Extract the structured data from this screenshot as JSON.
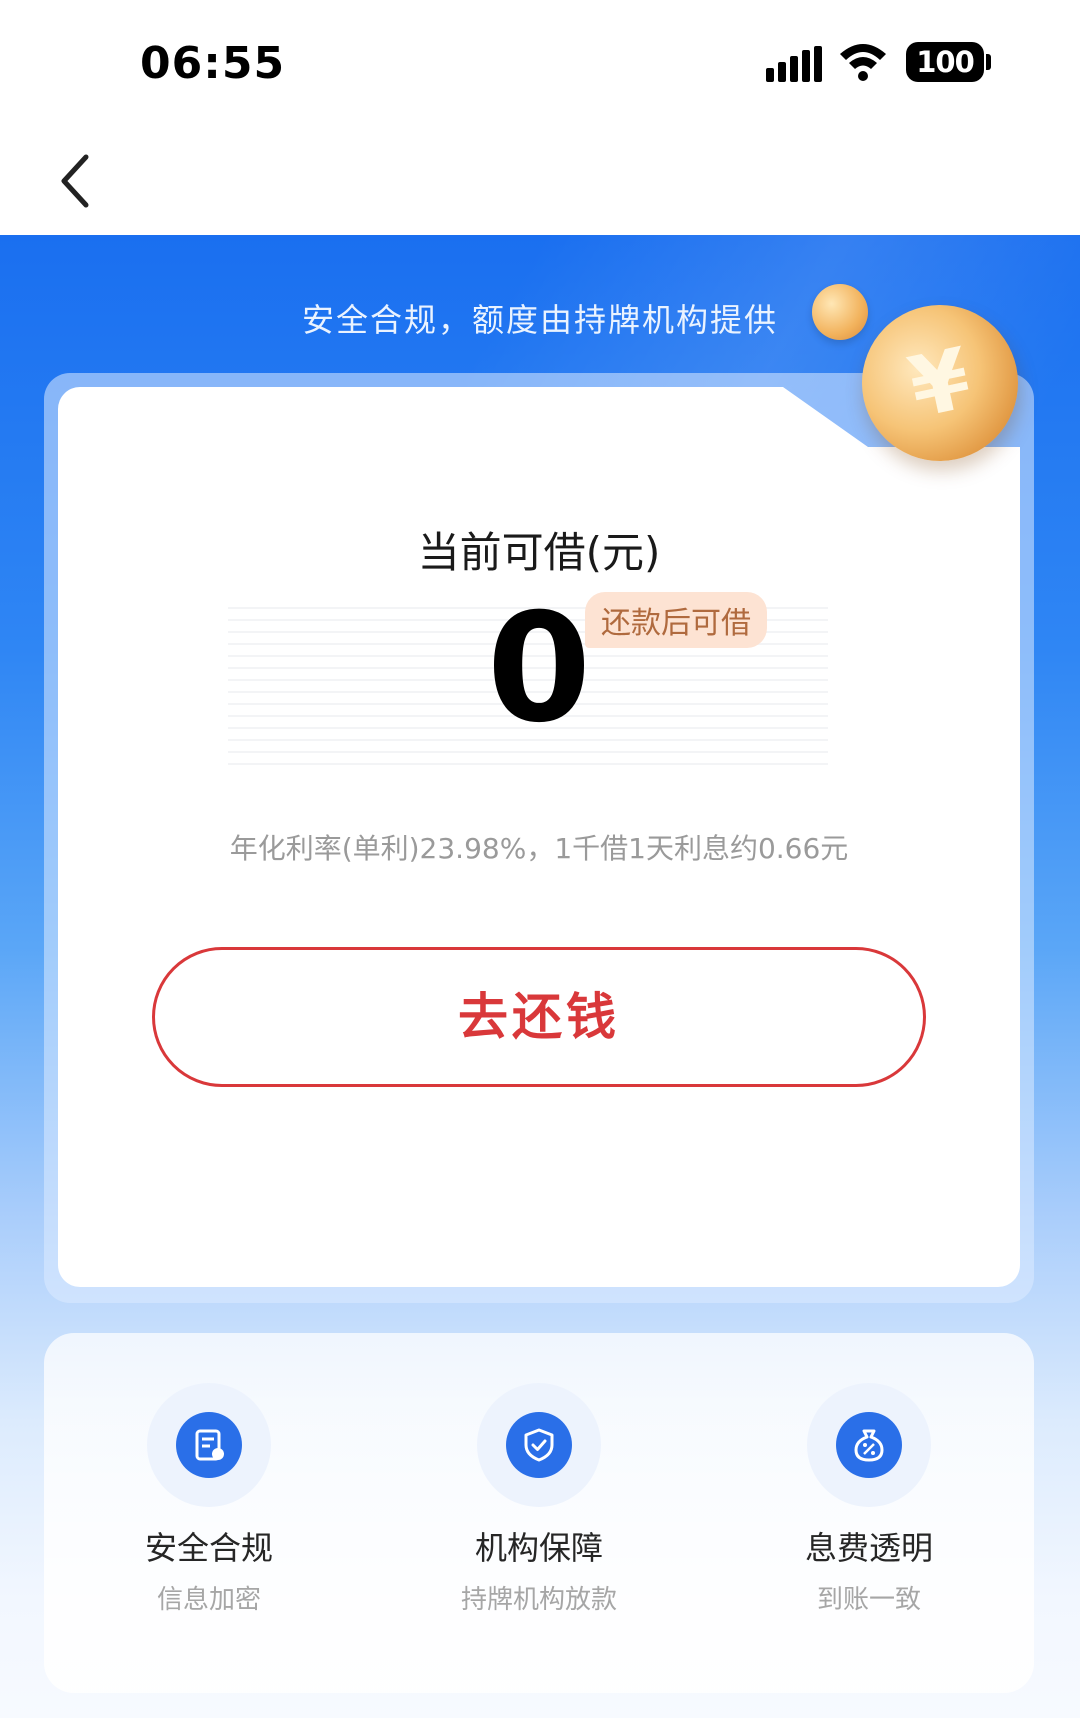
{
  "status_bar": {
    "time": "06:55",
    "battery": "100"
  },
  "header": {
    "back_icon": "chevron-left-icon"
  },
  "hero": {
    "tagline": "安全合规，额度由持牌机构提供"
  },
  "credit_card": {
    "title": "当前可借(元)",
    "amount": "0",
    "badge": "还款后可借",
    "rate_text": "年化利率(单利)23.98%，1千借1天利息约0.66元",
    "repay_button": "去还钱"
  },
  "features": [
    {
      "icon": "certificate-icon",
      "title": "安全合规",
      "subtitle": "信息加密"
    },
    {
      "icon": "shield-check-icon",
      "title": "机构保障",
      "subtitle": "持牌机构放款"
    },
    {
      "icon": "money-bag-icon",
      "title": "息费透明",
      "subtitle": "到账一致"
    }
  ],
  "colors": {
    "brand_blue": "#1a6ff0",
    "repay_red": "#d9383a",
    "badge_bg": "#fde3d3"
  }
}
